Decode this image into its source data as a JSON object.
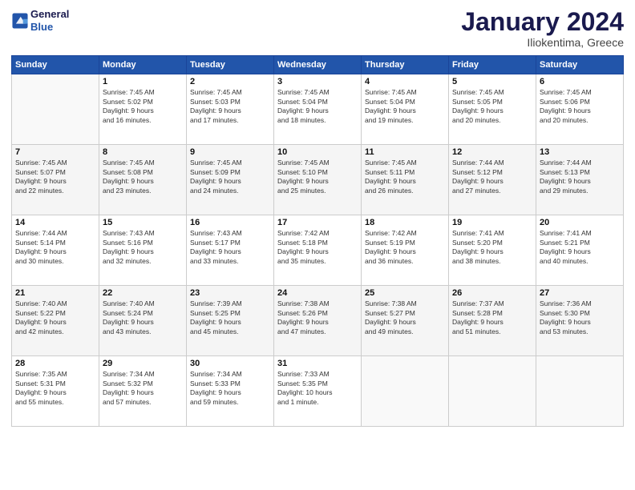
{
  "header": {
    "logo_line1": "General",
    "logo_line2": "Blue",
    "month": "January 2024",
    "location": "Iliokentima, Greece"
  },
  "weekdays": [
    "Sunday",
    "Monday",
    "Tuesday",
    "Wednesday",
    "Thursday",
    "Friday",
    "Saturday"
  ],
  "weeks": [
    [
      {
        "num": "",
        "info": ""
      },
      {
        "num": "1",
        "info": "Sunrise: 7:45 AM\nSunset: 5:02 PM\nDaylight: 9 hours\nand 16 minutes."
      },
      {
        "num": "2",
        "info": "Sunrise: 7:45 AM\nSunset: 5:03 PM\nDaylight: 9 hours\nand 17 minutes."
      },
      {
        "num": "3",
        "info": "Sunrise: 7:45 AM\nSunset: 5:04 PM\nDaylight: 9 hours\nand 18 minutes."
      },
      {
        "num": "4",
        "info": "Sunrise: 7:45 AM\nSunset: 5:04 PM\nDaylight: 9 hours\nand 19 minutes."
      },
      {
        "num": "5",
        "info": "Sunrise: 7:45 AM\nSunset: 5:05 PM\nDaylight: 9 hours\nand 20 minutes."
      },
      {
        "num": "6",
        "info": "Sunrise: 7:45 AM\nSunset: 5:06 PM\nDaylight: 9 hours\nand 20 minutes."
      }
    ],
    [
      {
        "num": "7",
        "info": "Sunrise: 7:45 AM\nSunset: 5:07 PM\nDaylight: 9 hours\nand 22 minutes."
      },
      {
        "num": "8",
        "info": "Sunrise: 7:45 AM\nSunset: 5:08 PM\nDaylight: 9 hours\nand 23 minutes."
      },
      {
        "num": "9",
        "info": "Sunrise: 7:45 AM\nSunset: 5:09 PM\nDaylight: 9 hours\nand 24 minutes."
      },
      {
        "num": "10",
        "info": "Sunrise: 7:45 AM\nSunset: 5:10 PM\nDaylight: 9 hours\nand 25 minutes."
      },
      {
        "num": "11",
        "info": "Sunrise: 7:45 AM\nSunset: 5:11 PM\nDaylight: 9 hours\nand 26 minutes."
      },
      {
        "num": "12",
        "info": "Sunrise: 7:44 AM\nSunset: 5:12 PM\nDaylight: 9 hours\nand 27 minutes."
      },
      {
        "num": "13",
        "info": "Sunrise: 7:44 AM\nSunset: 5:13 PM\nDaylight: 9 hours\nand 29 minutes."
      }
    ],
    [
      {
        "num": "14",
        "info": "Sunrise: 7:44 AM\nSunset: 5:14 PM\nDaylight: 9 hours\nand 30 minutes."
      },
      {
        "num": "15",
        "info": "Sunrise: 7:43 AM\nSunset: 5:16 PM\nDaylight: 9 hours\nand 32 minutes."
      },
      {
        "num": "16",
        "info": "Sunrise: 7:43 AM\nSunset: 5:17 PM\nDaylight: 9 hours\nand 33 minutes."
      },
      {
        "num": "17",
        "info": "Sunrise: 7:42 AM\nSunset: 5:18 PM\nDaylight: 9 hours\nand 35 minutes."
      },
      {
        "num": "18",
        "info": "Sunrise: 7:42 AM\nSunset: 5:19 PM\nDaylight: 9 hours\nand 36 minutes."
      },
      {
        "num": "19",
        "info": "Sunrise: 7:41 AM\nSunset: 5:20 PM\nDaylight: 9 hours\nand 38 minutes."
      },
      {
        "num": "20",
        "info": "Sunrise: 7:41 AM\nSunset: 5:21 PM\nDaylight: 9 hours\nand 40 minutes."
      }
    ],
    [
      {
        "num": "21",
        "info": "Sunrise: 7:40 AM\nSunset: 5:22 PM\nDaylight: 9 hours\nand 42 minutes."
      },
      {
        "num": "22",
        "info": "Sunrise: 7:40 AM\nSunset: 5:24 PM\nDaylight: 9 hours\nand 43 minutes."
      },
      {
        "num": "23",
        "info": "Sunrise: 7:39 AM\nSunset: 5:25 PM\nDaylight: 9 hours\nand 45 minutes."
      },
      {
        "num": "24",
        "info": "Sunrise: 7:38 AM\nSunset: 5:26 PM\nDaylight: 9 hours\nand 47 minutes."
      },
      {
        "num": "25",
        "info": "Sunrise: 7:38 AM\nSunset: 5:27 PM\nDaylight: 9 hours\nand 49 minutes."
      },
      {
        "num": "26",
        "info": "Sunrise: 7:37 AM\nSunset: 5:28 PM\nDaylight: 9 hours\nand 51 minutes."
      },
      {
        "num": "27",
        "info": "Sunrise: 7:36 AM\nSunset: 5:30 PM\nDaylight: 9 hours\nand 53 minutes."
      }
    ],
    [
      {
        "num": "28",
        "info": "Sunrise: 7:35 AM\nSunset: 5:31 PM\nDaylight: 9 hours\nand 55 minutes."
      },
      {
        "num": "29",
        "info": "Sunrise: 7:34 AM\nSunset: 5:32 PM\nDaylight: 9 hours\nand 57 minutes."
      },
      {
        "num": "30",
        "info": "Sunrise: 7:34 AM\nSunset: 5:33 PM\nDaylight: 9 hours\nand 59 minutes."
      },
      {
        "num": "31",
        "info": "Sunrise: 7:33 AM\nSunset: 5:35 PM\nDaylight: 10 hours\nand 1 minute."
      },
      {
        "num": "",
        "info": ""
      },
      {
        "num": "",
        "info": ""
      },
      {
        "num": "",
        "info": ""
      }
    ]
  ]
}
